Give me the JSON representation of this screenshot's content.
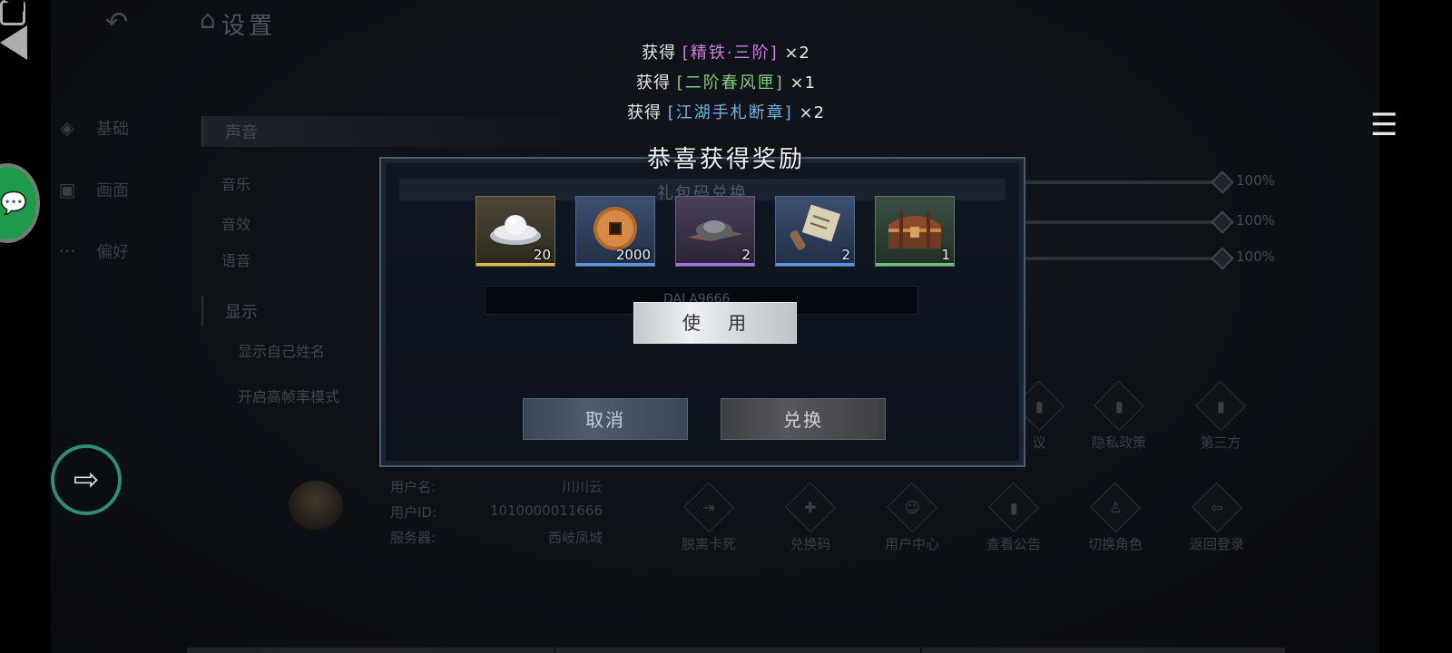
{
  "settings": {
    "title": "设置",
    "sidebar": [
      {
        "label": "基础",
        "icon": "layers-icon"
      },
      {
        "label": "画面",
        "icon": "image-icon"
      },
      {
        "label": "偏好",
        "icon": "more-icon"
      }
    ],
    "sound_section": "声音",
    "sound_options": [
      {
        "label": "音乐",
        "value": "100%"
      },
      {
        "label": "音效",
        "value": "100%"
      },
      {
        "label": "语音",
        "value": "100%"
      }
    ],
    "display_section": "显示",
    "display_options": [
      "显示自己姓名",
      "开启高帧率模式"
    ],
    "policy_buttons": [
      {
        "label": "议",
        "icon": "document-icon"
      },
      {
        "label": "隐私政策",
        "icon": "document-icon"
      },
      {
        "label": "第三方",
        "icon": "document-icon"
      }
    ],
    "user": {
      "name_label": "用户名:",
      "name_value": "川川云",
      "id_label": "用户ID:",
      "id_value": "1010000011666",
      "server_label": "服务器:",
      "server_value": "西岐凤城"
    },
    "action_buttons": [
      {
        "label": "脱离卡死",
        "icon": "unstuck-icon"
      },
      {
        "label": "兑换码",
        "icon": "gift-icon"
      },
      {
        "label": "用户中心",
        "icon": "user-center-icon"
      },
      {
        "label": "查看公告",
        "icon": "notice-icon"
      },
      {
        "label": "切换角色",
        "icon": "switch-role-icon"
      },
      {
        "label": "返回登录",
        "icon": "return-login-icon"
      }
    ]
  },
  "gift_dialog": {
    "title": "礼包码兑换",
    "code_text": "DALA9666",
    "cancel_label": "取消",
    "exchange_label": "兑换"
  },
  "gains": [
    {
      "prefix": "获得",
      "item": "[精铁·三阶]",
      "count": "×2",
      "color": "#cf7ee0"
    },
    {
      "prefix": "获得",
      "item": "[二阶春风匣]",
      "count": "×1",
      "color": "#7fd07a"
    },
    {
      "prefix": "获得",
      "item": "[江湖手札断章]",
      "count": "×2",
      "color": "#6fb2e6"
    }
  ],
  "reward": {
    "title": "恭喜获得奖励",
    "items": [
      {
        "icon": "silver-ingot-icon",
        "qty": "20",
        "rarity": "gold"
      },
      {
        "icon": "copper-coin-icon",
        "qty": "2000",
        "rarity": "blue"
      },
      {
        "icon": "iron-ore-icon",
        "qty": "2",
        "rarity": "purple"
      },
      {
        "icon": "scroll-icon",
        "qty": "2",
        "rarity": "blue"
      },
      {
        "icon": "treasure-chest-icon",
        "qty": "1",
        "rarity": "green"
      }
    ],
    "use_label": "使 用"
  }
}
